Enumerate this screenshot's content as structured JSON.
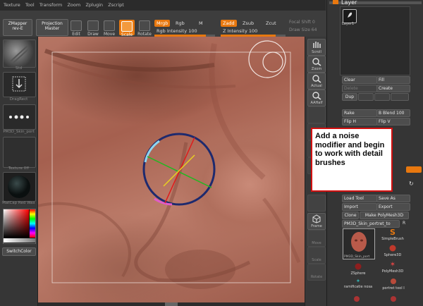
{
  "menubar": {
    "items": [
      "Texture",
      "Tool",
      "Transform",
      "Zoom",
      "Zplugin",
      "Zscript"
    ]
  },
  "toolbar": {
    "zmapper": "ZMapper",
    "zmapper_sub": "rev-E",
    "projection": "Projection",
    "projection_sub": "Master",
    "edit": "Edit",
    "draw": "Draw",
    "move": "Move",
    "scale": "Scale",
    "rotate": "Rotate",
    "mrgb": "Mrgb",
    "rgb": "Rgb",
    "m": "M",
    "rgb_intensity": "Rgb Intensity 100",
    "zadd": "Zadd",
    "zsub": "Zsub",
    "zcut": "Zcut",
    "z_intensity": "Z Intensity 100",
    "focal_shift": "Focal Shift 0",
    "draw_size": "Draw Size 64",
    "rgb_intensity_level": 0.85,
    "z_intensity_level": 0.85
  },
  "leftshelf": {
    "brush_label": "Std",
    "stroke_label": "DragRect",
    "alpha_label": "PM3D_Skin_port",
    "texture_label": "Texture 0ff",
    "material_label": "MatCap Red Wax",
    "switch_color": "SwitchColor"
  },
  "rightshelf": {
    "scroll": "Scroll",
    "zoom": "Zoom",
    "actual": "Actual",
    "aahalf": "AAHalf",
    "frame": "Frame",
    "move": "Move",
    "scale": "Scale",
    "rotate": "Rotate"
  },
  "palette": {
    "layer_title": "Layer",
    "layer_thumb": "Layer1",
    "clear": "Clear",
    "fill": "Fill",
    "delete": "Delete",
    "create": "Create",
    "dup": "Dup",
    "rake": "Rake",
    "blend": "B Blend 100",
    "flip_h": "Flip H",
    "flip_v": "Flip V",
    "load_tool": "Load Tool",
    "save_as": "Save As",
    "import": "Import",
    "export": "Export",
    "clone": "Clone",
    "make_polymesh": "Make PolyMesh3D",
    "current_tool": "PM3D_Skin_portret_to",
    "r": "R",
    "tool_thumb_label": "PM3D_Skin_port",
    "simple_brush": "SimpleBrush",
    "sphere3d": "Sphere3D",
    "zsphere": "ZSphere",
    "polymesh3d": "PolyMesh3D",
    "ramification": "ramificatie nosa",
    "portret_tool": "portret tool I"
  },
  "note": {
    "text": "Add a noise modifier and begin to work with detail brushes"
  }
}
